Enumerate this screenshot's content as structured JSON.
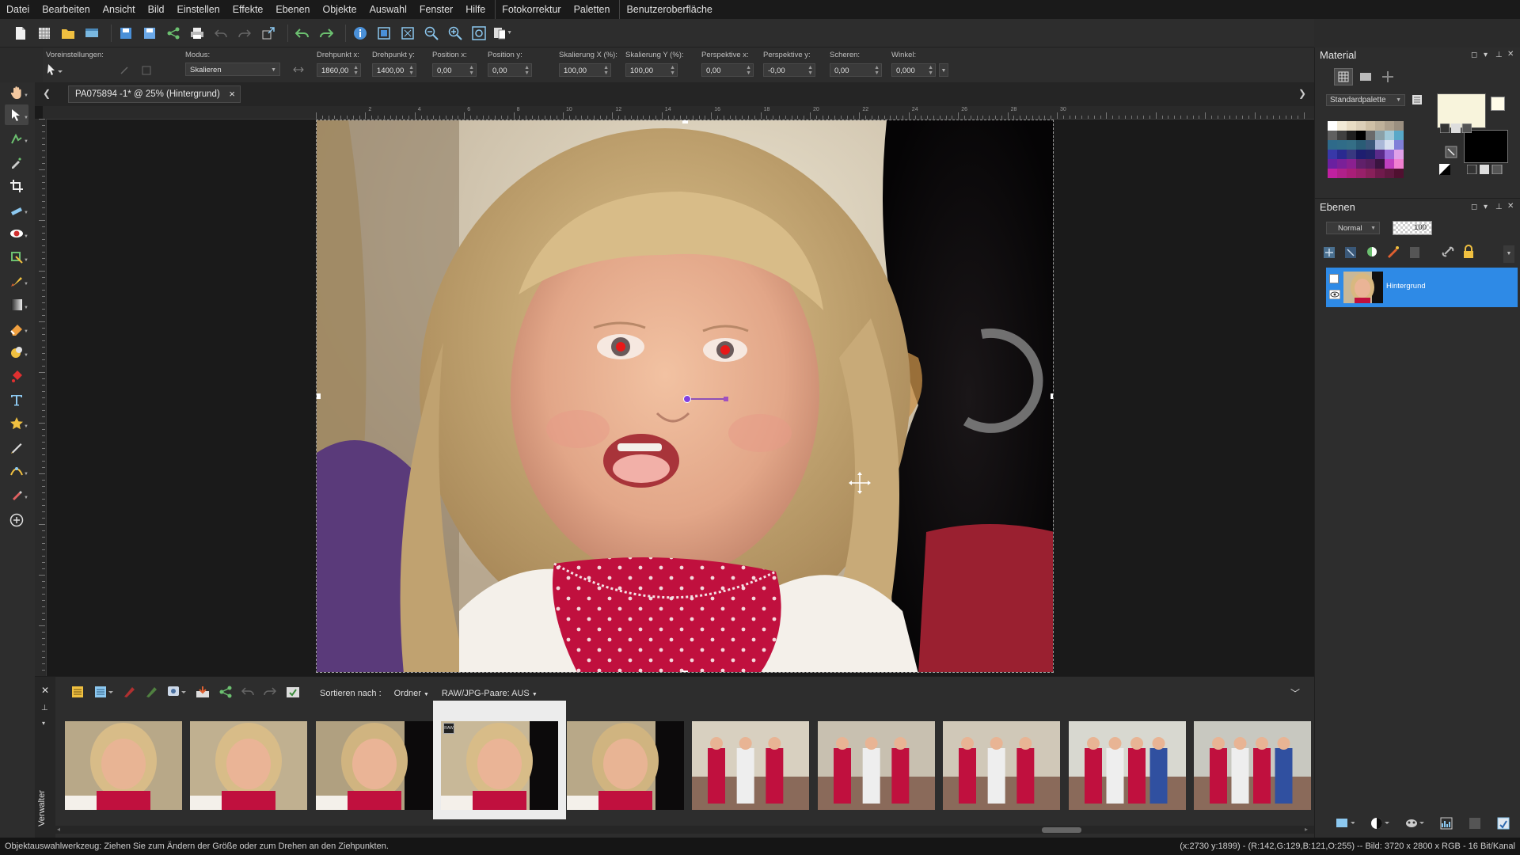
{
  "menu": [
    "Datei",
    "Bearbeiten",
    "Ansicht",
    "Bild",
    "Einstellen",
    "Effekte",
    "Ebenen",
    "Objekte",
    "Auswahl",
    "Fenster",
    "Hilfe",
    "Fotokorrektur",
    "Paletten",
    "Benutzeroberfläche"
  ],
  "options": {
    "presets_label": "Voreinstellungen:",
    "mode_label": "Modus:",
    "mode_value": "Skalieren",
    "fields": [
      {
        "label": "Drehpunkt x:",
        "value": "1860,00"
      },
      {
        "label": "Drehpunkt y:",
        "value": "1400,00"
      },
      {
        "label": "Position x:",
        "value": "0,00"
      },
      {
        "label": "Position y:",
        "value": "0,00"
      },
      {
        "label": "Skalierung X (%):",
        "value": "100,00"
      },
      {
        "label": "Skalierung Y (%):",
        "value": "100,00"
      },
      {
        "label": "Perspektive x:",
        "value": "0,00"
      },
      {
        "label": "Perspektive y:",
        "value": "-0,00"
      },
      {
        "label": "Scheren:",
        "value": "0,00"
      },
      {
        "label": "Winkel:",
        "value": "0,000"
      }
    ]
  },
  "document": {
    "tab_title": "PA075894 -1* @  25% (Hintergrund)",
    "close_icon": "×"
  },
  "ruler": {
    "top_numbers": [
      "2",
      "4",
      "6",
      "8",
      "10",
      "12",
      "14",
      "16",
      "18",
      "20",
      "22",
      "24",
      "26",
      "28",
      "30"
    ]
  },
  "material": {
    "title": "Material",
    "palette_select": "Standardpalette",
    "fg_color": "#f8f4dc",
    "bg_color": "#000000",
    "swatches": [
      "#ffffff",
      "#f2ead7",
      "#e8dcc4",
      "#dccfb8",
      "#cfc0a6",
      "#bfb19a",
      "#ada08d",
      "#9a8f80",
      "#606060",
      "#404040",
      "#202020",
      "#000000",
      "#6a6a6a",
      "#8aa0a8",
      "#a0c8d8",
      "#58a8c8",
      "#2e6a8a",
      "#306c88",
      "#346e86",
      "#2a5c76",
      "#3a587a",
      "#aab8d8",
      "#d8e0f0",
      "#8080d8",
      "#3838a8",
      "#2a2a90",
      "#383880",
      "#1e1e70",
      "#22226a",
      "#5a2a8a",
      "#9a6ad8",
      "#e0a0e8",
      "#6a20a0",
      "#7a2098",
      "#8a2090",
      "#60206a",
      "#581e5e",
      "#3a1440",
      "#c040c0",
      "#f080d0",
      "#c020a0",
      "#b0208a",
      "#a81e78",
      "#98206a",
      "#88205a",
      "#701a4c",
      "#601840",
      "#501030"
    ]
  },
  "layers": {
    "title": "Ebenen",
    "blend_mode": "Normal",
    "opacity": "100",
    "items": [
      {
        "name": "Hintergrund"
      }
    ]
  },
  "organizer": {
    "sort_label": "Sortieren nach :",
    "sort_value": "Ordner",
    "raw_label": "RAW/JPG-Paare: AUS",
    "side_label": "Verwalter",
    "raw_badge": "RAW"
  },
  "status": {
    "left": "Objektauswahlwerkzeug: Ziehen Sie zum Ändern der Größe oder zum Drehen an den Ziehpunkten.",
    "right": "(x:2730 y:1899) - (R:142,G:129,B:121,O:255) -- Bild:  3720 x 2800 x RGB - 16 Bit/Kanal"
  }
}
